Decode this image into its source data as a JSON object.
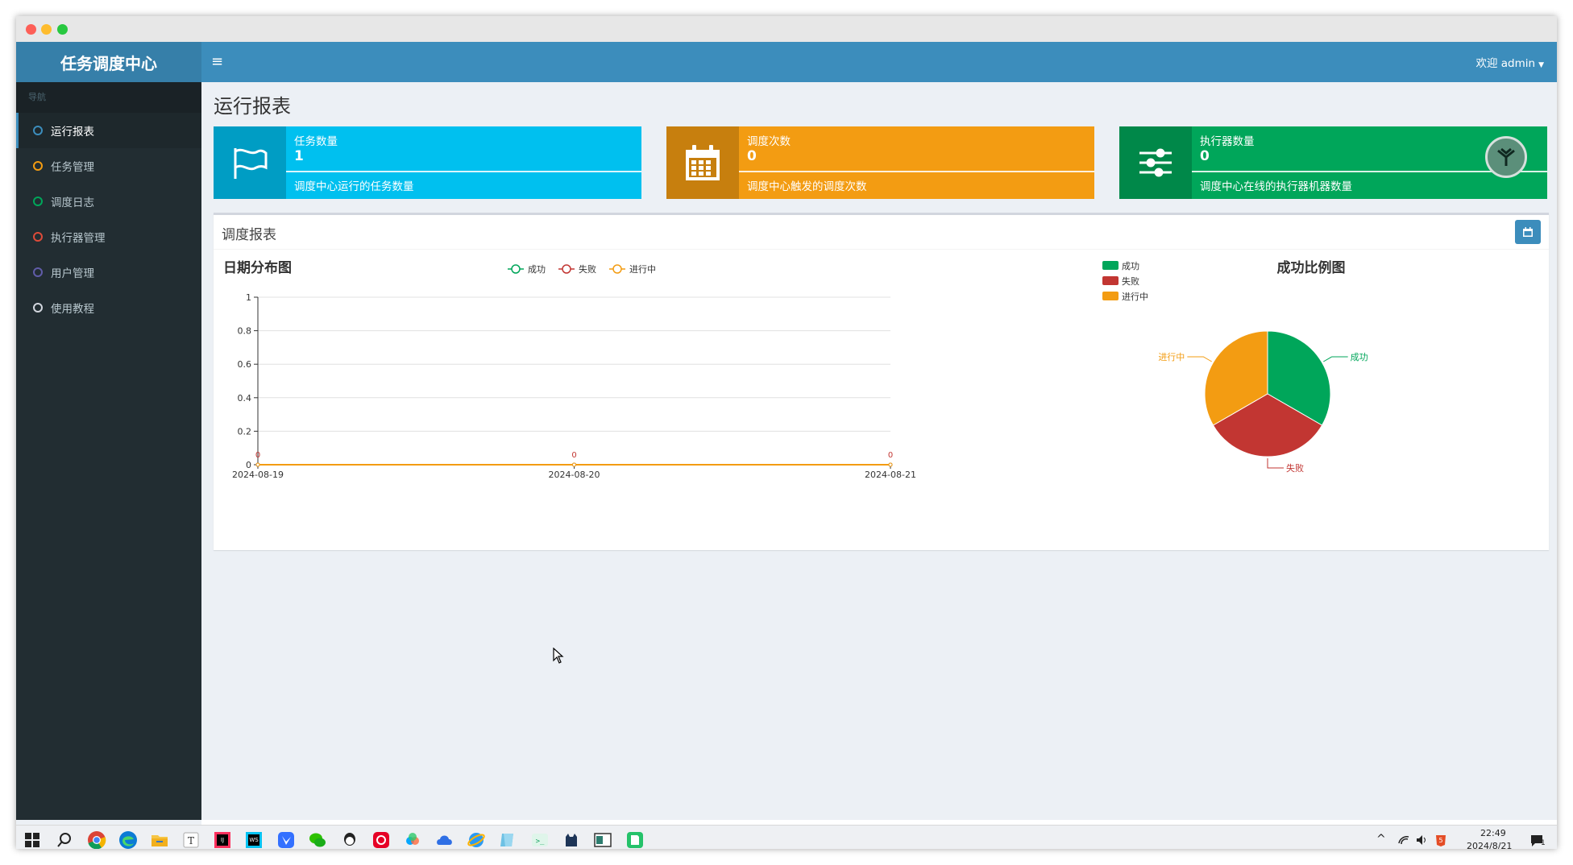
{
  "app": {
    "brand": "任务调度中心",
    "nav_header": "导航",
    "greeting": "欢迎 admin"
  },
  "sidebar": {
    "items": [
      {
        "label": "运行报表",
        "color": "#3c8dbc"
      },
      {
        "label": "任务管理",
        "color": "#f39c12"
      },
      {
        "label": "调度日志",
        "color": "#00a65a"
      },
      {
        "label": "执行器管理",
        "color": "#dd4b39"
      },
      {
        "label": "用户管理",
        "color": "#605ca8"
      },
      {
        "label": "使用教程",
        "color": "#d2d6de"
      }
    ]
  },
  "page": {
    "title": "运行报表"
  },
  "info_boxes": [
    {
      "title": "任务数量",
      "value": "1",
      "desc": "调度中心运行的任务数量",
      "icon": "flag-icon",
      "color": "#00c0ef"
    },
    {
      "title": "调度次数",
      "value": "0",
      "desc": "调度中心触发的调度次数",
      "icon": "calendar-icon",
      "color": "#f39c12"
    },
    {
      "title": "执行器数量",
      "value": "0",
      "desc": "调度中心在线的执行器机器数量",
      "icon": "sliders-icon",
      "color": "#00a65a"
    }
  ],
  "report": {
    "title": "调度报表"
  },
  "chart_data": [
    {
      "type": "line",
      "title": "日期分布图",
      "x": [
        "2024-08-19",
        "2024-08-20",
        "2024-08-21"
      ],
      "series": [
        {
          "name": "成功",
          "values": [
            0,
            0,
            0
          ],
          "color": "#00a65a"
        },
        {
          "name": "失败",
          "values": [
            0,
            0,
            0
          ],
          "color": "#c23632"
        },
        {
          "name": "进行中",
          "values": [
            0,
            0,
            0
          ],
          "color": "#f39c12"
        }
      ],
      "ylim": [
        0,
        1
      ],
      "yticks": [
        "0",
        "0.2",
        "0.4",
        "0.6",
        "0.8",
        "1"
      ],
      "grid": true,
      "legend": "top-center"
    },
    {
      "type": "pie",
      "title": "成功比例图",
      "labels": [
        "成功",
        "失败",
        "进行中"
      ],
      "values": [
        1,
        1,
        1
      ],
      "colors": [
        "#00a65a",
        "#c23632",
        "#f39c12"
      ],
      "legend": "top-left"
    }
  ],
  "taskbar": {
    "time": "22:49",
    "date": "2024/8/21",
    "notification_count": "1"
  }
}
